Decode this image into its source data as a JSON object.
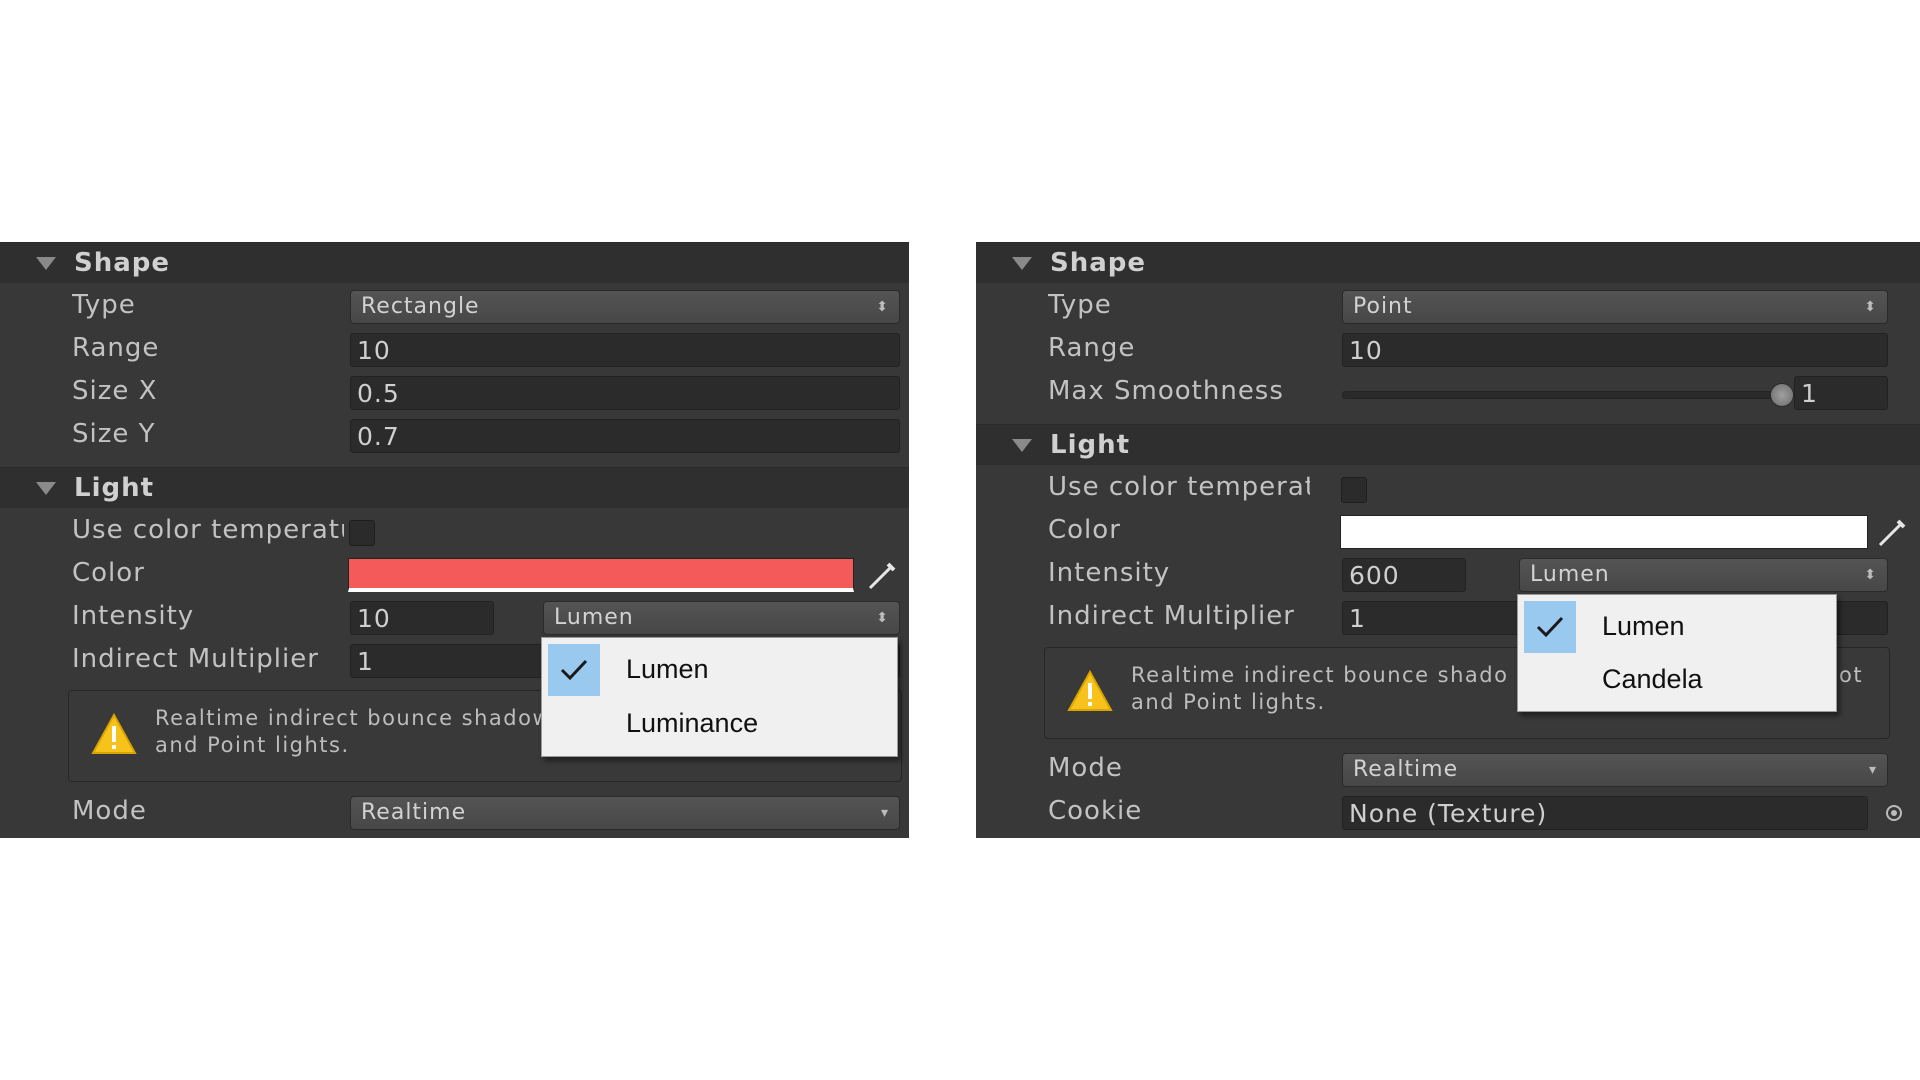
{
  "left_panel": {
    "shape_header": "Shape",
    "type_label": "Type",
    "type_value": "Rectangle",
    "range_label": "Range",
    "range_value": "10",
    "size_x_label": "Size X",
    "size_x_value": "0.5",
    "size_y_label": "Size Y",
    "size_y_value": "0.7",
    "light_header": "Light",
    "use_color_temp_label": "Use color temperatu",
    "color_label": "Color",
    "color_value": "#f45a5a",
    "intensity_label": "Intensity",
    "intensity_value": "10",
    "intensity_unit": "Lumen",
    "indirect_label": "Indirect Multiplier",
    "indirect_value": "1",
    "help_line1": "Realtime indirect bounce shadow",
    "help_line2": "and Point lights.",
    "mode_label": "Mode",
    "mode_value": "Realtime",
    "unit_options": [
      "Lumen",
      "Luminance"
    ],
    "selected_unit": "Lumen"
  },
  "right_panel": {
    "shape_header": "Shape",
    "type_label": "Type",
    "type_value": "Point",
    "range_label": "Range",
    "range_value": "10",
    "smoothness_label": "Max Smoothness",
    "smoothness_value": "1",
    "light_header": "Light",
    "use_color_temp_label": "Use color temperatur",
    "color_label": "Color",
    "color_value": "#ffffff",
    "intensity_label": "Intensity",
    "intensity_value": "600",
    "intensity_unit": "Lumen",
    "indirect_label": "Indirect Multiplier",
    "indirect_value": "1",
    "help_line1": "Realtime indirect bounce shado",
    "help_line1_tail": "ot",
    "help_line2": "and Point lights.",
    "mode_label": "Mode",
    "mode_value": "Realtime",
    "cookie_label": "Cookie",
    "cookie_value": "None (Texture)",
    "unit_options": [
      "Lumen",
      "Candela"
    ],
    "selected_unit": "Lumen"
  },
  "icons": {
    "foldout": "triangle-down-icon",
    "picker": "eyedropper-icon",
    "warning": "warning-icon",
    "check": "checkmark-icon",
    "object_picker": "object-picker-icon"
  },
  "colors": {
    "panel_bg": "#383838",
    "header_bg": "#2f2f2f",
    "popup_bg": "#f0f0f0",
    "check_highlight": "#99c9ef",
    "warning_yellow": "#f6c21b"
  }
}
